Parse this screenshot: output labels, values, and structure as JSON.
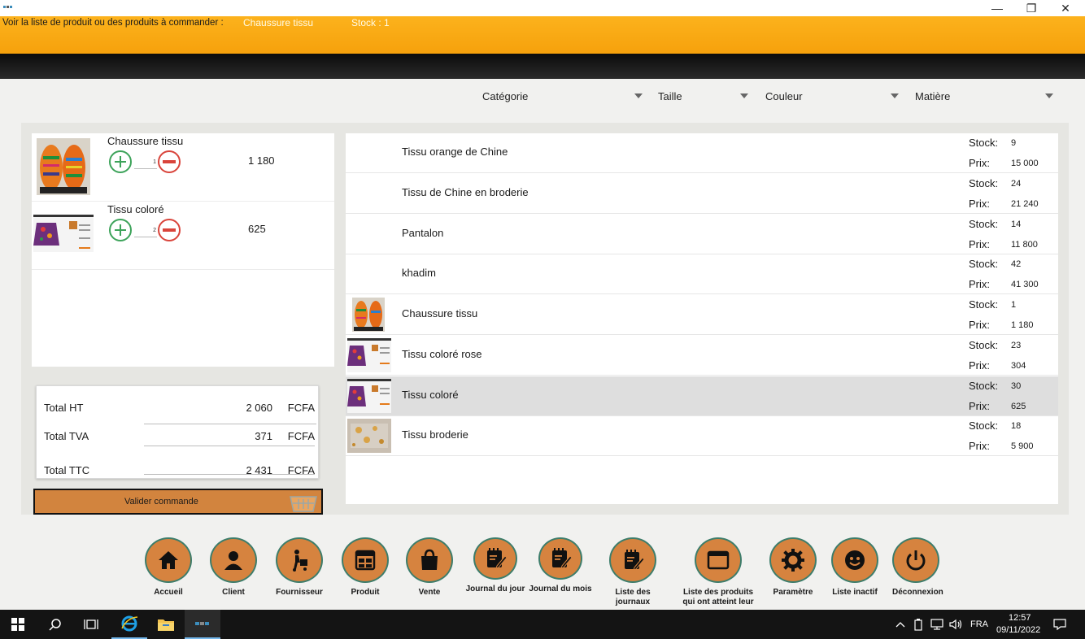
{
  "header": {
    "caption": "Voir la liste de produit ou des produits à commander :",
    "current_product": "Chaussure tissu",
    "current_stock": "Stock : 1"
  },
  "window_controls": {
    "minimize": "—",
    "maximize": "❐",
    "close": "✕"
  },
  "filters": [
    "Catégorie",
    "Taille",
    "Couleur",
    "Matière"
  ],
  "cart": {
    "items": [
      {
        "name": "Chaussure tissu",
        "qty": "1",
        "price": "1 180",
        "thumb": "shoe"
      },
      {
        "name": "Tissu coloré",
        "qty": "2",
        "price": "625",
        "thumb": "fabric"
      }
    ]
  },
  "totals": {
    "ht": {
      "label": "Total HT",
      "value": "2 060",
      "unit": "FCFA"
    },
    "tva": {
      "label": "Total TVA",
      "value": "371",
      "unit": "FCFA"
    },
    "ttc": {
      "label": "Total TTC",
      "value": "2 431",
      "unit": "FCFA"
    }
  },
  "validate_label": "Valider commande",
  "products": {
    "stock_label": "Stock:",
    "price_label": "Prix:",
    "items": [
      {
        "name": "Tissu orange de Chine",
        "stock": "9",
        "price": "15 000",
        "thumb": ""
      },
      {
        "name": "Tissu de Chine en broderie",
        "stock": "24",
        "price": "21 240",
        "thumb": ""
      },
      {
        "name": "Pantalon",
        "stock": "14",
        "price": "11 800",
        "thumb": ""
      },
      {
        "name": "khadim",
        "stock": "42",
        "price": "41 300",
        "thumb": ""
      },
      {
        "name": "Chaussure tissu",
        "stock": "1",
        "price": "1 180",
        "thumb": "shoe"
      },
      {
        "name": "Tissu coloré rose",
        "stock": "23",
        "price": "304",
        "thumb": "fabric"
      },
      {
        "name": "Tissu coloré",
        "stock": "30",
        "price": "625",
        "thumb": "fabric",
        "selected": true
      },
      {
        "name": "Tissu broderie",
        "stock": "18",
        "price": "5 900",
        "thumb": "embroidery"
      }
    ]
  },
  "nav": [
    {
      "label": "Accueil",
      "icon": "home-icon"
    },
    {
      "label": "Client",
      "icon": "user-icon"
    },
    {
      "label": "Fournisseur",
      "icon": "delivery-icon"
    },
    {
      "label": "Produit",
      "icon": "product-grid-icon"
    },
    {
      "label": "Vente",
      "icon": "shopping-bag-icon"
    },
    {
      "label": "Journal du jour",
      "icon": "journal-icon"
    },
    {
      "label": "Journal du mois",
      "icon": "journal-icon"
    },
    {
      "label": "Liste des journaux",
      "icon": "journal-icon"
    },
    {
      "label": "Liste des produits qui ont atteint leur",
      "icon": "window-icon"
    },
    {
      "label": "Paramètre",
      "icon": "gear-icon"
    },
    {
      "label": "Liste inactif",
      "icon": "face-icon"
    },
    {
      "label": "Déconnexion",
      "icon": "power-icon"
    }
  ],
  "taskbar": {
    "lang": "FRA",
    "time": "12:57",
    "date": "09/11/2022"
  }
}
